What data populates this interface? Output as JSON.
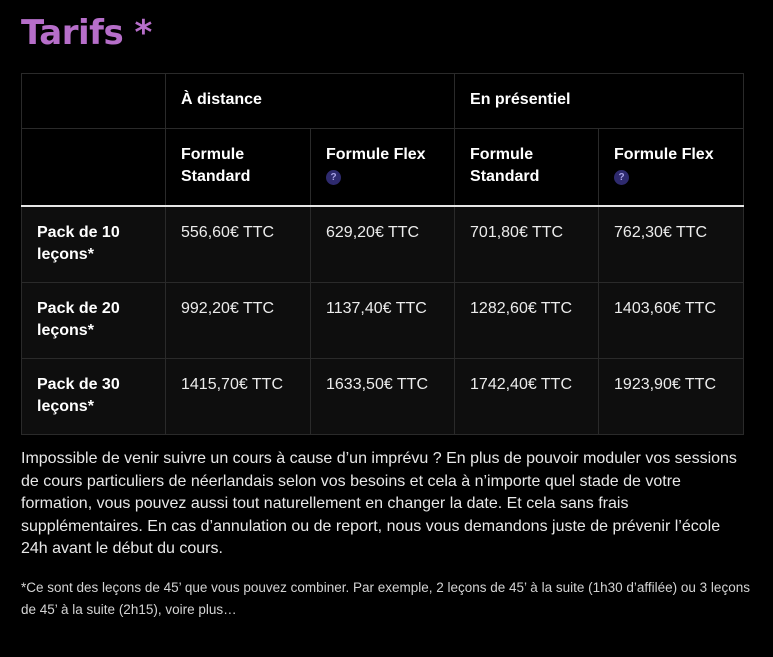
{
  "title": "Tarifs *",
  "table": {
    "groups": [
      "À distance",
      "En présentiel"
    ],
    "columns": [
      "Formule Standard",
      "Formule Flex",
      "Formule Standard",
      "Formule Flex"
    ],
    "help_icon_glyph": "?",
    "rows": [
      {
        "label": "Pack de 10 leçons*",
        "cells": [
          "556,60€ TTC",
          "629,20€ TTC",
          "701,80€ TTC",
          "762,30€ TTC"
        ]
      },
      {
        "label": "Pack de 20 leçons*",
        "cells": [
          "992,20€ TTC",
          "1137,40€ TTC",
          "1282,60€ TTC",
          "1403,60€ TTC"
        ]
      },
      {
        "label": "Pack de 30 leçons*",
        "cells": [
          "1415,70€ TTC",
          "1633,50€ TTC",
          "1742,40€ TTC",
          "1923,90€ TTC"
        ]
      }
    ]
  },
  "paragraph": "Impossible de venir suivre un cours à cause d’un imprévu ? En plus de pouvoir moduler vos sessions de cours particuliers de néerlandais selon vos besoins et cela à n’importe quel stade de votre formation, vous pouvez aussi tout naturellement en changer la date. Et cela sans frais supplémentaires. En cas d’annulation ou de report, nous vous demandons juste de prévenir l’école 24h avant le début du cours.",
  "footnote": "*Ce sont des leçons de 45’ que vous pouvez combiner. Par exemple, 2 leçons de 45’ à la suite (1h30 d’affilée) ou 3 leçons de 45’ à la suite (2h15), voire plus…",
  "colors": {
    "title": "#b66ec9",
    "help_icon_bg": "#2e2a6e",
    "background": "#000000",
    "table_body_bg": "#0e0e0e"
  }
}
